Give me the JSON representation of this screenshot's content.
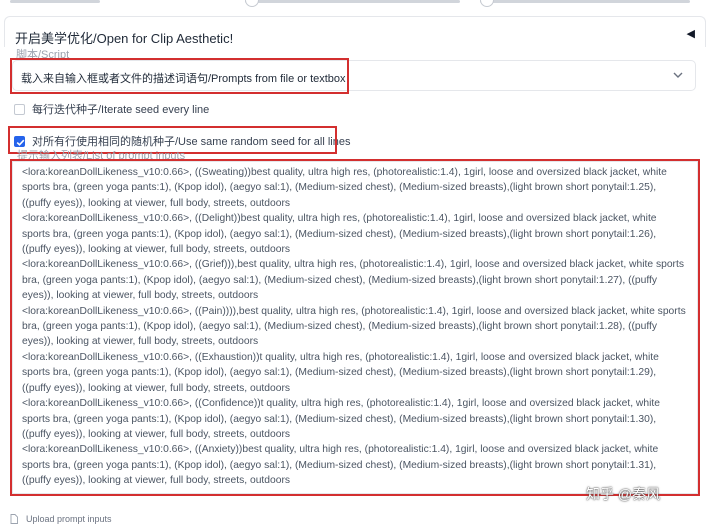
{
  "panel": {
    "title": "开启美学优化/Open for Clip Aesthetic!",
    "collapse_icon": "triangle-left-icon"
  },
  "script": {
    "label": "脚本/Script",
    "selected": "载入来自输入框或者文件的描述词语句/Prompts from file or textbox"
  },
  "options": {
    "iterate_seed": {
      "label": "每行迭代种子/Iterate seed every line",
      "checked": false
    },
    "same_seed": {
      "label": "对所有行使用相同的随机种子/Use same random seed for all lines",
      "checked": true
    }
  },
  "prompt_list": {
    "label": "提示输入列表/List of prompt inputs",
    "lines": [
      "<lora:koreanDollLikeness_v10:0.66>, ((Sweating))best quality, ultra high res, (photorealistic:1.4), 1girl, loose and oversized black jacket, white sports bra, (green yoga pants:1), (Kpop idol), (aegyo sal:1), (Medium-sized chest), (Medium-sized breasts),(light brown short ponytail:1.25), ((puffy eyes)), looking at viewer, full body, streets, outdoors",
      "<lora:koreanDollLikeness_v10:0.66>, ((Delight))best quality, ultra high res, (photorealistic:1.4), 1girl, loose and oversized black jacket, white sports bra, (green yoga pants:1), (Kpop idol), (aegyo sal:1), (Medium-sized chest), (Medium-sized breasts),(light brown short ponytail:1.26), ((puffy eyes)), looking at viewer, full body, streets, outdoors",
      "<lora:koreanDollLikeness_v10:0.66>, ((Grief))),best quality, ultra high res, (photorealistic:1.4), 1girl, loose and oversized black jacket, white sports bra, (green yoga pants:1), (Kpop idol), (aegyo sal:1), (Medium-sized chest), (Medium-sized breasts),(light brown short ponytail:1.27), ((puffy eyes)), looking at viewer, full body, streets, outdoors",
      "<lora:koreanDollLikeness_v10:0.66>, ((Pain)))),best quality, ultra high res, (photorealistic:1.4), 1girl, loose and oversized black jacket, white sports bra, (green yoga pants:1), (Kpop idol), (aegyo sal:1), (Medium-sized chest), (Medium-sized breasts),(light brown short ponytail:1.28), ((puffy eyes)), looking at viewer, full body, streets, outdoors",
      "<lora:koreanDollLikeness_v10:0.66>, ((Exhaustion))t quality, ultra high res, (photorealistic:1.4), 1girl, loose and oversized black jacket, white sports bra, (green yoga pants:1), (Kpop idol), (aegyo sal:1), (Medium-sized chest), (Medium-sized breasts),(light brown short ponytail:1.29), ((puffy eyes)), looking at viewer, full body, streets, outdoors",
      "<lora:koreanDollLikeness_v10:0.66>, ((Confidence))t quality, ultra high res, (photorealistic:1.4), 1girl, loose and oversized black jacket, white sports bra, (green yoga pants:1), (Kpop idol), (aegyo sal:1), (Medium-sized chest), (Medium-sized breasts),(light brown short ponytail:1.30), ((puffy eyes)), looking at viewer, full body, streets, outdoors",
      "<lora:koreanDollLikeness_v10:0.66>, ((Anxiety))best quality, ultra high res, (photorealistic:1.4), 1girl, loose and oversized black jacket, white sports bra, (green yoga pants:1), (Kpop idol), (aegyo sal:1), (Medium-sized chest), (Medium-sized breasts),(light brown short ponytail:1.31), ((puffy eyes)), looking at viewer, full body, streets, outdoors"
    ]
  },
  "upload": {
    "label": "Upload prompt inputs",
    "icon": "file-icon"
  },
  "watermark": "知乎 @秦风",
  "colors": {
    "highlight": "#d32f2f",
    "accent": "#2563eb"
  }
}
